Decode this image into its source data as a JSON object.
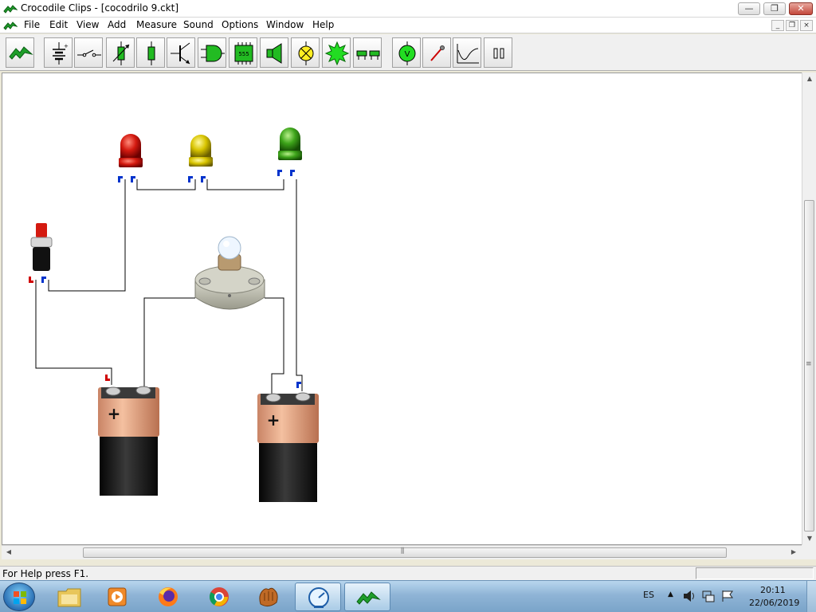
{
  "window": {
    "title": "Crocodile Clips - [cocodrilo 9.ckt]",
    "minimize_glyph": "—",
    "restore_glyph": "❐",
    "close_glyph": "✕"
  },
  "menu": {
    "items": [
      "File",
      "Edit",
      "View",
      "Add",
      "Measure",
      "Sound",
      "Options",
      "Window",
      "Help"
    ],
    "mdi_min": "_",
    "mdi_restore": "❐",
    "mdi_close": "×"
  },
  "toolbar": {
    "tools": [
      "crocodile-logo-icon",
      "battery-icon",
      "switch-icon",
      "variable-resistor-icon",
      "resistor-icon",
      "transistor-icon",
      "logic-gate-icon",
      "timer-555-icon",
      "speaker-icon",
      "lamp-icon",
      "led-icon",
      "connector-icon",
      "voltmeter-icon",
      "probe-icon",
      "graph-icon",
      "pause-icon"
    ],
    "chip_label": "555",
    "voltmeter_label": "V"
  },
  "circuit": {
    "components": [
      "red-led",
      "yellow-led",
      "green-led",
      "push-switch",
      "light-bulb",
      "battery-left",
      "battery-right"
    ],
    "battery_plus": "+",
    "colors": {
      "led_red": "#d41a10",
      "led_yellow": "#d8c400",
      "led_green": "#3da41a",
      "battery_copper": "#e0a080",
      "battery_black": "#1e1e1e",
      "terminal_blue": "#0033cc",
      "terminal_red": "#d00000"
    }
  },
  "scrollbars": {
    "grip": "≡",
    "hgrip": "⫼"
  },
  "status": {
    "help_text": "For Help press F1."
  },
  "taskbar": {
    "apps": [
      "explorer-icon",
      "media-player-icon",
      "firefox-icon",
      "chrome-icon",
      "baseball-glove-icon",
      "clock-gauge-icon",
      "crocodile-clips-icon"
    ],
    "language": "ES",
    "time": "20:11",
    "date": "22/06/2019"
  }
}
